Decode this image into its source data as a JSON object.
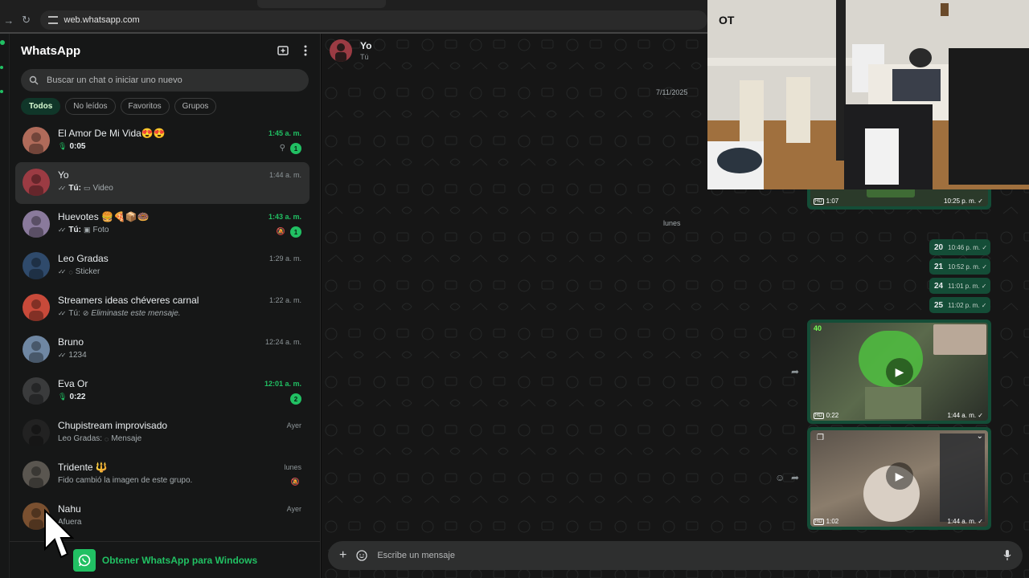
{
  "browser": {
    "url": "web.whatsapp.com"
  },
  "sidebar": {
    "title": "WhatsApp",
    "search_placeholder": "Buscar un chat o iniciar uno nuevo",
    "filters": [
      "Todos",
      "No leídos",
      "Favoritos",
      "Grupos"
    ],
    "active_filter": "Todos",
    "footer_text": "Obtener WhatsApp para Windows"
  },
  "chats": [
    {
      "name": "El Amor De Mi Vida😍😍",
      "time": "1:45 a. m.",
      "unread": true,
      "badge": "1",
      "pinned": true,
      "sub_icon": "mic",
      "sub_prefix": "",
      "sub_text": "0:05",
      "selected": false,
      "avatar_color": "#b06b5a"
    },
    {
      "name": "Yo",
      "time": "1:44 a. m.",
      "unread": false,
      "badge": "",
      "pinned": false,
      "sub_icon": "video",
      "sub_prefix": "Tú:",
      "sub_text": "Video",
      "selected": true,
      "avatar_color": "#9b3b43"
    },
    {
      "name": "Huevotes 🍔🍕📦🍩",
      "time": "1:43 a. m.",
      "unread": true,
      "badge": "1",
      "muted": true,
      "sub_icon": "photo",
      "sub_prefix": "Tú:",
      "sub_text": "Foto",
      "selected": false,
      "avatar_color": "#8a7a9c"
    },
    {
      "name": "Leo Gradas",
      "time": "1:29 a. m.",
      "unread": false,
      "badge": "",
      "sub_icon": "sticker",
      "sub_prefix": "",
      "sub_text": "Sticker",
      "selected": false,
      "avatar_color": "#2f4a6b"
    },
    {
      "name": "Streamers ideas chéveres carnal",
      "time": "1:22 a. m.",
      "unread": false,
      "badge": "",
      "sub_icon": "deleted",
      "sub_prefix": "Tú:",
      "sub_text": "Eliminaste este mensaje.",
      "selected": false,
      "avatar_color": "#c84a3a"
    },
    {
      "name": "Bruno",
      "time": "12:24 a. m.",
      "unread": false,
      "badge": "",
      "sub_icon": "check",
      "sub_prefix": "",
      "sub_text": "1234",
      "selected": false,
      "avatar_color": "#6f87a3"
    },
    {
      "name": "Eva Or",
      "time": "12:01 a. m.",
      "unread": true,
      "badge": "2",
      "sub_icon": "mic",
      "sub_prefix": "",
      "sub_text": "0:22",
      "selected": false,
      "avatar_color": "#3a3b3c"
    },
    {
      "name": "Chupistream improvisado",
      "time": "Ayer",
      "unread": false,
      "badge": "",
      "sub_icon": "loading",
      "sub_prefix": "Leo Gradas:",
      "sub_text": "Mensaje",
      "selected": false,
      "avatar_color": "#222222"
    },
    {
      "name": "Tridente 🔱",
      "time": "lunes",
      "unread": false,
      "badge": "",
      "muted": true,
      "sub_icon": "none",
      "sub_prefix": "",
      "sub_text": "Fido cambió la imagen de este grupo.",
      "selected": false,
      "avatar_color": "#5a5650"
    },
    {
      "name": "Nahu",
      "time": "Ayer",
      "unread": false,
      "badge": "",
      "sub_icon": "none",
      "sub_prefix": "",
      "sub_text": "Afuera",
      "selected": false,
      "avatar_color": "#7a5030"
    }
  ],
  "conversation": {
    "name": "Yo",
    "status": "Tú",
    "date_labels": [
      "7/11/2025",
      "lunes"
    ],
    "small_messages": [
      {
        "num": "20",
        "time": "10:46 p. m. ✓"
      },
      {
        "num": "21",
        "time": "10:52 p. m. ✓"
      },
      {
        "num": "24",
        "time": "11:01 p. m. ✓"
      },
      {
        "num": "25",
        "time": "11:02 p. m. ✓"
      }
    ],
    "videos": [
      {
        "duration": "1:07",
        "time": "10:25 p. m. ✓"
      },
      {
        "duration": "0:22",
        "time": "1:44 a. m. ✓"
      },
      {
        "duration": "1:02",
        "time": "1:44 a. m. ✓"
      }
    ],
    "composer_placeholder": "Escribe un mensaje"
  },
  "colors": {
    "accent": "#21c063",
    "bubble": "#144d37",
    "panel": "#161717"
  }
}
